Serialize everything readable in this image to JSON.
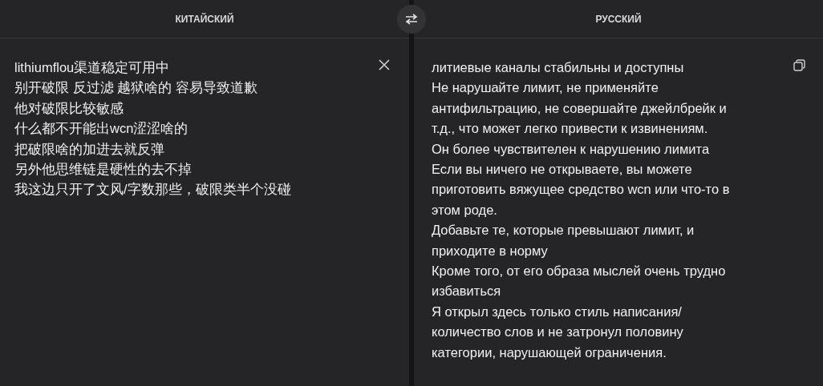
{
  "source_language": "КИТАЙСКИЙ",
  "target_language": "РУССКИЙ",
  "source_lines": [
    "lithiumflou渠道稳定可用中",
    "别开破限 反过滤 越狱啥的 容易导致道歉",
    "他对破限比较敏感",
    "什么都不开能出wcn涩涩啥的",
    "把破限啥的加进去就反弹",
    "另外他思维链是硬性的去不掉",
    "我这边只开了文风/字数那些，破限类半个没碰"
  ],
  "translation_lines": [
    "литиевые каналы стабильны и доступны",
    "Не нарушайте лимит, не применяйте",
    "антифильтрацию, не совершайте джейлбрейк и",
    "т.д., что может легко привести к извинениям.",
    "Он более чувствителен к нарушению лимита",
    "Если вы ничего не открываете, вы можете",
    "приготовить вяжущее средство wcn или что-то в",
    "этом роде.",
    "Добавьте те, которые превышают лимит, и",
    "приходите в норму",
    "Кроме того, от его образа мыслей очень трудно",
    "избавиться",
    "Я открыл здесь только стиль написания/",
    "количество слов и не затронул половину",
    "категории, нарушающей ограничения."
  ]
}
